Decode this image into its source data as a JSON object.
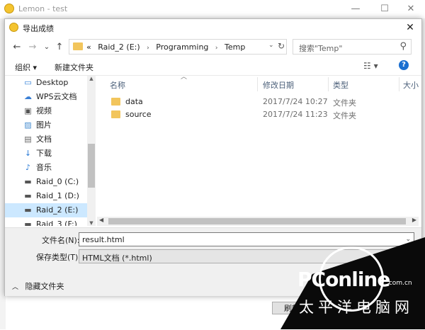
{
  "background_window": {
    "title": "Lemon - test",
    "minimize": "—",
    "maximize": "☐",
    "close": "✕",
    "button_label": "刷新"
  },
  "dialog": {
    "title": "导出成绩",
    "close": "✕"
  },
  "nav": {
    "back": "←",
    "forward": "→",
    "dropdown": "⌄",
    "up": "↑",
    "breadcrumbs": [
      "«",
      "Raid_2 (E:)",
      "Programming",
      "Temp"
    ],
    "separator": "›",
    "address_dropdown": "⌄",
    "refresh": "↻",
    "search_placeholder": "搜索\"Temp\"",
    "search_icon": "⚲"
  },
  "commandbar": {
    "organize": "组织 ▾",
    "new_folder": "新建文件夹",
    "view": "☷ ▾",
    "help": "?"
  },
  "tree": {
    "items": [
      {
        "label": "Desktop",
        "icon": "desktop-icon",
        "glyph": "▭",
        "color": "#2b7bd6"
      },
      {
        "label": "WPS云文档",
        "icon": "cloud-icon",
        "glyph": "☁",
        "color": "#3a7fd5"
      },
      {
        "label": "视频",
        "icon": "video-icon",
        "glyph": "▣",
        "color": "#555555"
      },
      {
        "label": "图片",
        "icon": "picture-icon",
        "glyph": "▨",
        "color": "#4a8fd0"
      },
      {
        "label": "文档",
        "icon": "document-icon",
        "glyph": "▤",
        "color": "#666666"
      },
      {
        "label": "下载",
        "icon": "download-icon",
        "glyph": "↓",
        "color": "#2b7bd6"
      },
      {
        "label": "音乐",
        "icon": "music-icon",
        "glyph": "♪",
        "color": "#2b7bd6"
      },
      {
        "label": "Raid_0 (C:)",
        "icon": "drive-icon",
        "glyph": "▬",
        "color": "#555555"
      },
      {
        "label": "Raid_1 (D:)",
        "icon": "drive-icon",
        "glyph": "▬",
        "color": "#555555"
      },
      {
        "label": "Raid_2 (E:)",
        "icon": "drive-icon",
        "glyph": "▬",
        "color": "#555555"
      },
      {
        "label": "Raid_3 (F:)",
        "icon": "drive-icon",
        "glyph": "▬",
        "color": "#555555"
      }
    ],
    "selected_index": 9,
    "scroll_up": "▲",
    "scroll_down": "▼"
  },
  "columns": {
    "sort_indicator": "︿",
    "name": "名称",
    "modified": "修改日期",
    "type": "类型",
    "size": "大小"
  },
  "files": [
    {
      "name": "data",
      "modified": "2017/7/24 10:27",
      "type": "文件夹"
    },
    {
      "name": "source",
      "modified": "2017/7/24 11:23",
      "type": "文件夹"
    }
  ],
  "hscroll": {
    "left": "◀",
    "right": "▶"
  },
  "bottom": {
    "filename_label": "文件名(N):",
    "filename_value": "result.html",
    "filename_dropdown": "⌄",
    "filetype_label": "保存类型(T):",
    "filetype_value": "HTML文档 (*.html)",
    "hide_folders": "隐藏文件夹",
    "hide_chevron": "︿"
  },
  "watermark": {
    "brand": "PConline",
    "domain": ".com.cn",
    "cn_text": "太平洋电脑网"
  },
  "colors": {
    "selection": "#cce8ff",
    "accent": "#1a6fd0",
    "folder": "#f2c55c"
  }
}
